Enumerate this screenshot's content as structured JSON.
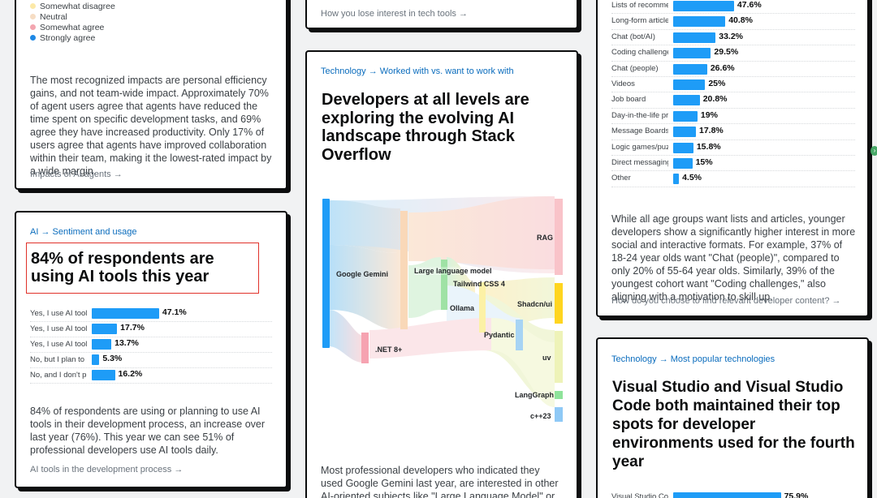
{
  "card_agents": {
    "legend": [
      {
        "label": "Somewhat disagree",
        "color": "#fce9a8"
      },
      {
        "label": "Neutral",
        "color": "#f6ddc4"
      },
      {
        "label": "Somewhat agree",
        "color": "#f3a6b0"
      },
      {
        "label": "Strongly agree",
        "color": "#1e88e5"
      }
    ],
    "paragraph": "The most recognized impacts are personal efficiency gains, and not team-wide impact. Approximately 70% of agent users agree that agents have reduced the time spent on specific development tasks, and 69% agree they have increased productivity. Only 17% of users agree that agents have improved collaboration within their team, making it the lowest-rated impact by a wide margin.",
    "link": "Impacts of AI agents →"
  },
  "card_ai_tools": {
    "breadcrumb": "AI → Sentiment and usage",
    "title": "84% of respondents are using AI tools this year",
    "bars": [
      {
        "label": "Yes, I use AI tools daily",
        "value": 47.1,
        "display": "47.1%"
      },
      {
        "label": "Yes, I use AI tools weekly",
        "value": 17.7,
        "display": "17.7%"
      },
      {
        "label": "Yes, I use AI tools monthly",
        "value": 13.7,
        "display": "13.7%"
      },
      {
        "label": "No, but I plan to soon",
        "value": 5.3,
        "display": "5.3%"
      },
      {
        "label": "No, and I don't plan to",
        "value": 16.2,
        "display": "16.2%"
      }
    ],
    "paragraph": "84% of respondents are using or planning to use AI tools in their development process, an increase over last year (76%). This year we can see 51% of professional developers use AI tools daily.",
    "link": "AI tools in the development process →"
  },
  "card_interest": {
    "link": "How you lose interest in tech tools →"
  },
  "card_sankey": {
    "breadcrumb": "Technology → Worked with vs. want to work with",
    "title": "Developers at all levels are exploring the evolving AI landscape through Stack Overflow",
    "labels": {
      "google_gemini": "Google Gemini",
      "llm": "Large language model",
      "tailwind": "Tailwind CSS 4",
      "ollama": "Ollama",
      "rag": "RAG",
      "shadcn": "Shadcn/ui",
      "pydantic": "Pydantic",
      "net8": ".NET 8+",
      "uv": "uv",
      "langgraph": "LangGraph",
      "cpp23": "c++23"
    },
    "paragraph": "Most professional developers who indicated they used Google Gemini last year, are interested in other AI-oriented subjects like \"Large Language Model\" or \"RAG\", and tools like"
  },
  "card_content": {
    "bars": [
      {
        "label": "Lists of recommendations",
        "value": 47.6,
        "display": "47.6%"
      },
      {
        "label": "Long-form articles",
        "value": 40.8,
        "display": "40.8%"
      },
      {
        "label": "Chat (bot/AI)",
        "value": 33.2,
        "display": "33.2%"
      },
      {
        "label": "Coding challenges",
        "value": 29.5,
        "display": "29.5%"
      },
      {
        "label": "Chat (people)",
        "value": 26.6,
        "display": "26.6%"
      },
      {
        "label": "Videos",
        "value": 25,
        "display": "25%"
      },
      {
        "label": "Job board",
        "value": 20.8,
        "display": "20.8%"
      },
      {
        "label": "Day-in-the-life profiles",
        "value": 19,
        "display": "19%"
      },
      {
        "label": "Message Boards",
        "value": 17.8,
        "display": "17.8%"
      },
      {
        "label": "Logic games/puzzles",
        "value": 15.8,
        "display": "15.8%"
      },
      {
        "label": "Direct messaging channels",
        "value": 15,
        "display": "15%"
      },
      {
        "label": "Other",
        "value": 4.5,
        "display": "4.5%"
      }
    ],
    "paragraph": "While all age groups want lists and articles, younger developers show a significantly higher interest in more social and interactive formats. For example, 37% of 18-24 year olds want \"Chat (people)\", compared to only 20% of 55-64 year olds. Similarly, 39% of the youngest cohort want \"Coding challenges,\" also aligning with a motivation to skill up.",
    "link": "How do you choose to find relevant developer content? →"
  },
  "card_vscode": {
    "breadcrumb": "Technology → Most popular technologies",
    "title": "Visual Studio and Visual Studio Code both maintained their top spots for developer environments used for the fourth year",
    "bars": [
      {
        "label": "Visual Studio Code",
        "value": 75.9,
        "display": "75.9%"
      }
    ]
  },
  "colors": {
    "accent": "#1e9cf7",
    "link": "#0a6cbd",
    "highlight": "#e0312a"
  }
}
